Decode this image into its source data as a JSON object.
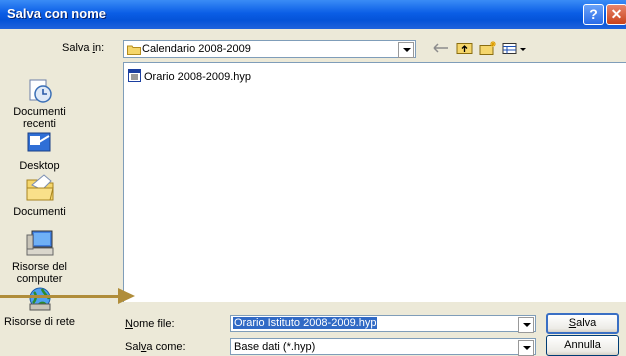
{
  "window": {
    "title": "Salva con nome",
    "help_glyph": "?",
    "close_glyph": "✕"
  },
  "savein": {
    "label_prefix": "Salva ",
    "label_accel": "i",
    "label_suffix": "n:",
    "value": "Calendario 2008-2009"
  },
  "toolbar": {
    "back_icon": "back-arrow-icon",
    "up_icon": "up-folder-icon",
    "new_folder_icon": "new-folder-icon",
    "views_icon": "views-menu-icon"
  },
  "places": [
    {
      "label": "Documenti recenti",
      "icon": "recent-documents-icon"
    },
    {
      "label": "Desktop",
      "icon": "desktop-icon"
    },
    {
      "label": "Documenti",
      "icon": "documents-icon"
    },
    {
      "label": "Risorse del computer",
      "icon": "my-computer-icon"
    },
    {
      "label": "Risorse di rete",
      "icon": "network-places-icon"
    }
  ],
  "files": [
    {
      "name": "Orario 2008-2009.hyp",
      "icon": "hyp-file-icon"
    }
  ],
  "filename": {
    "label_accel": "N",
    "label_rest": "ome file:",
    "value": "Orario Istituto 2008-2009.hyp"
  },
  "filetype": {
    "label_prefix": "Sal",
    "label_accel": "v",
    "label_suffix": "a come:",
    "value": "Base dati (*.hyp)"
  },
  "buttons": {
    "save_accel": "S",
    "save_rest": "alva",
    "cancel": "Annulla"
  },
  "colors": {
    "titlebar": "#0453d8",
    "arrow": "#b08d3a",
    "selection": "#316ac5"
  }
}
